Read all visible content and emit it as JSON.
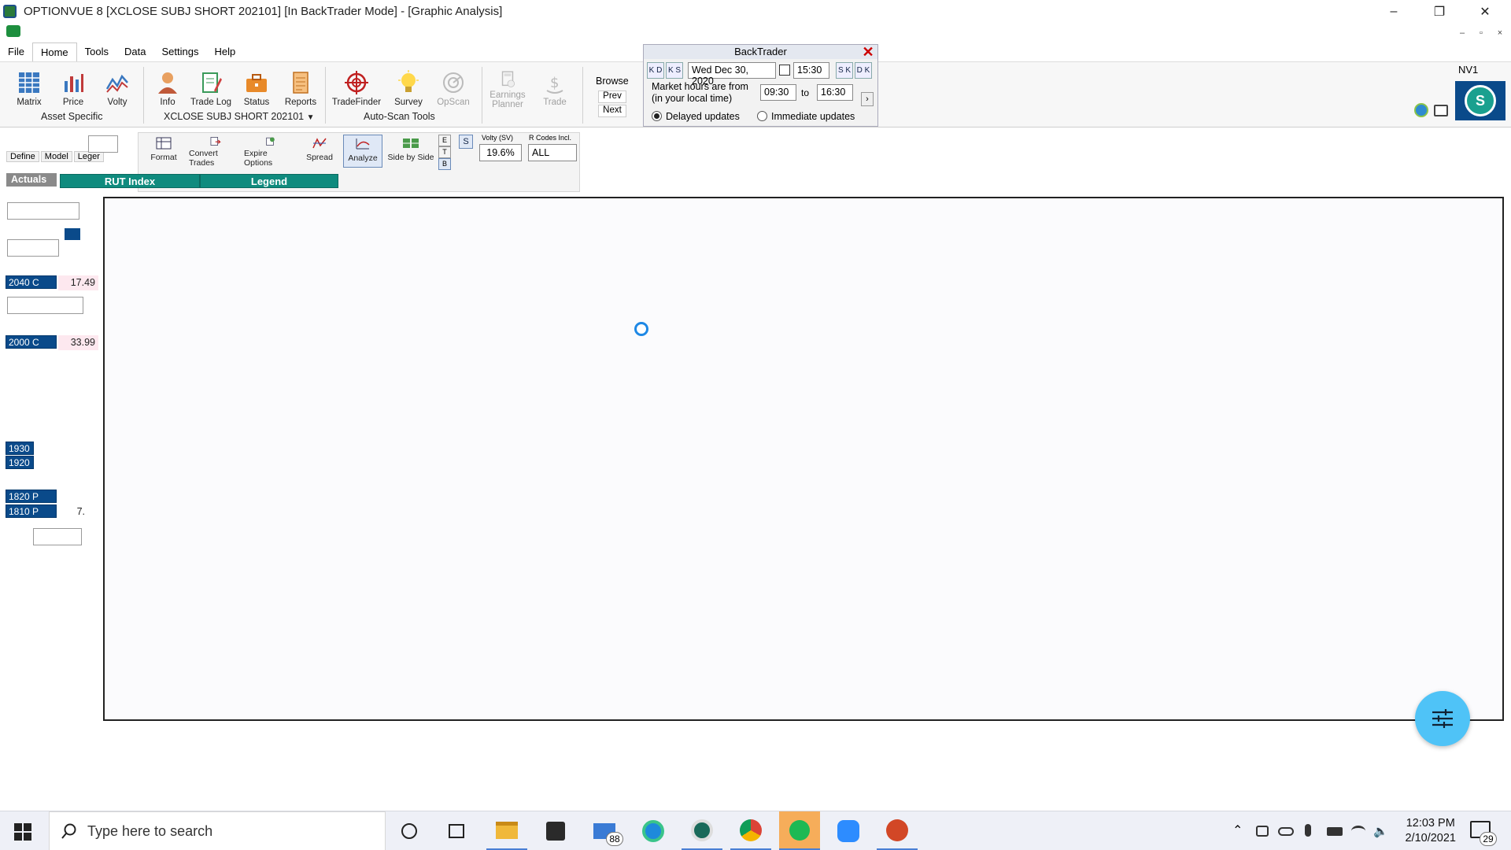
{
  "window": {
    "title": "OPTIONVUE 8   [XCLOSE SUBJ SHORT 202101]   [In BackTrader Mode] - [Graphic Analysis]",
    "minimize": "–",
    "restore": "❐",
    "close": "✕"
  },
  "mdi": {
    "minimize": "–",
    "restore": "▫",
    "close": "×"
  },
  "menu": [
    "File",
    "Home",
    "Tools",
    "Data",
    "Settings",
    "Help"
  ],
  "ribbon": {
    "asset_buttons": [
      "Matrix",
      "Price",
      "Volty"
    ],
    "asset_group": "Asset Specific",
    "portfolio_buttons": [
      "Info",
      "Trade Log",
      "Status",
      "Reports"
    ],
    "portfolio_group": "XCLOSE SUBJ SHORT 202101",
    "scan_buttons": [
      "TradeFinder",
      "Survey",
      "OpScan"
    ],
    "scan_group": "Auto-Scan Tools",
    "earnings": [
      "Earnings",
      "Planner"
    ],
    "trade": "Trade",
    "browse": {
      "title": "Browse",
      "prev": "Prev",
      "next": "Next"
    },
    "nv_label": "NV1",
    "avatar_letter": "S"
  },
  "backtrader": {
    "title": "BackTrader",
    "date": "Wed Dec 30, 2020",
    "time": "15:30",
    "nav_left_day": "K D",
    "nav_left_step": "K S",
    "nav_right_step": "S K",
    "nav_right_day": "D K",
    "market_hours_line1": "Market hours are from",
    "market_hours_line2": "(in your local time)",
    "from": "09:30",
    "to_label": "to",
    "to": "16:30",
    "delayed": "Delayed updates",
    "immediate": "Immediate updates",
    "selected": "delayed"
  },
  "toolbar2": {
    "left_tabs": [
      "Define",
      "Model",
      "Leger"
    ],
    "buttons": [
      "Format",
      "Convert Trades",
      "Expire Options",
      "Spread",
      "Analyze",
      "Side by Side"
    ],
    "active": "Analyze",
    "etb": [
      "E",
      "T",
      "B"
    ],
    "s_label": "S",
    "volty_label": "Volty (SV)",
    "volty_value": "19.6%",
    "rcodes_label": "R Codes Incl.",
    "rcodes_value": "ALL"
  },
  "tabs": {
    "actuals": "Actuals",
    "index": "RUT Index",
    "legend": "Legend"
  },
  "positions": [
    {
      "label": "2040 C",
      "value": "17.49"
    },
    {
      "label": "2000 C",
      "value": "33.99"
    },
    {
      "label": "1930",
      "value": ""
    },
    {
      "label": "1920",
      "value": ""
    },
    {
      "label": "1820 P",
      "value": ""
    },
    {
      "label": "1810 P",
      "value": "7."
    }
  ],
  "taskbar": {
    "search_placeholder": "Type here to search",
    "mail_badge": "88",
    "time": "12:03 PM",
    "date": "2/10/2021",
    "notif_count": "29"
  },
  "colors": {
    "teal": "#0f8b7e",
    "navy": "#0a4a8a",
    "pink": "#fde8ef",
    "accent_blue": "#4fc3f7"
  }
}
